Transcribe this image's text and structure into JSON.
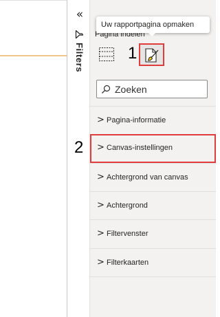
{
  "filters_pane": {
    "collapse_icon": "double-chevron-left-icon",
    "funnel_icon": "filter-icon",
    "label": "Filters"
  },
  "format_pane": {
    "header": "Pagina indelen",
    "tooltip": "Uw rapportpagina opmaken",
    "build_visual_icon": "build-visual-icon",
    "format_page_icon": "format-brush-icon",
    "search": {
      "placeholder": "Zoeken",
      "value": ""
    },
    "sections": [
      {
        "label": "Pagina-informatie",
        "highlighted": false
      },
      {
        "label": "Canvas-instellingen",
        "highlighted": true
      },
      {
        "label": "Achtergrond van canvas",
        "highlighted": false
      },
      {
        "label": "Achtergrond",
        "highlighted": false
      },
      {
        "label": "Filtervenster",
        "highlighted": false
      },
      {
        "label": "Filterkaarten",
        "highlighted": false
      }
    ],
    "chevron": ">"
  },
  "callouts": {
    "step1": "1",
    "step2": "2"
  },
  "colors": {
    "highlight": "#e03c3c",
    "pane_background": "#f3f2f1",
    "page_edge": "#f0c58c"
  }
}
